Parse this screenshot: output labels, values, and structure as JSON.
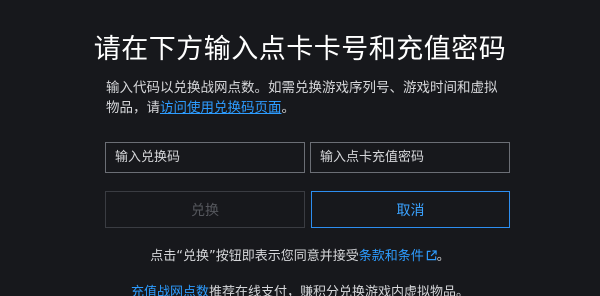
{
  "title": "请在下方输入点卡卡号和充值密码",
  "description": {
    "text": "输入代码以兑换战网点数。如需兑换游戏序列号、游戏时间和虚拟物品，请",
    "link_label": "访问使用兑换码页面",
    "suffix": "。"
  },
  "fields": {
    "code_placeholder": "输入兑换码",
    "pin_placeholder": "输入点卡充值密码"
  },
  "buttons": {
    "redeem_label": "兑换",
    "cancel_label": "取消"
  },
  "terms": {
    "prefix": "点击“兑换”按钮即表示您同意并接受",
    "link_label": "条款和条件",
    "link_icon": "external-link-icon",
    "suffix": "。"
  },
  "footer": {
    "link_label": "充值战网点数",
    "text": "推荐在线支付，赚积分兑换游戏内虚拟物品。"
  },
  "colors": {
    "background": "#17181c",
    "accent": "#2d9cff"
  }
}
